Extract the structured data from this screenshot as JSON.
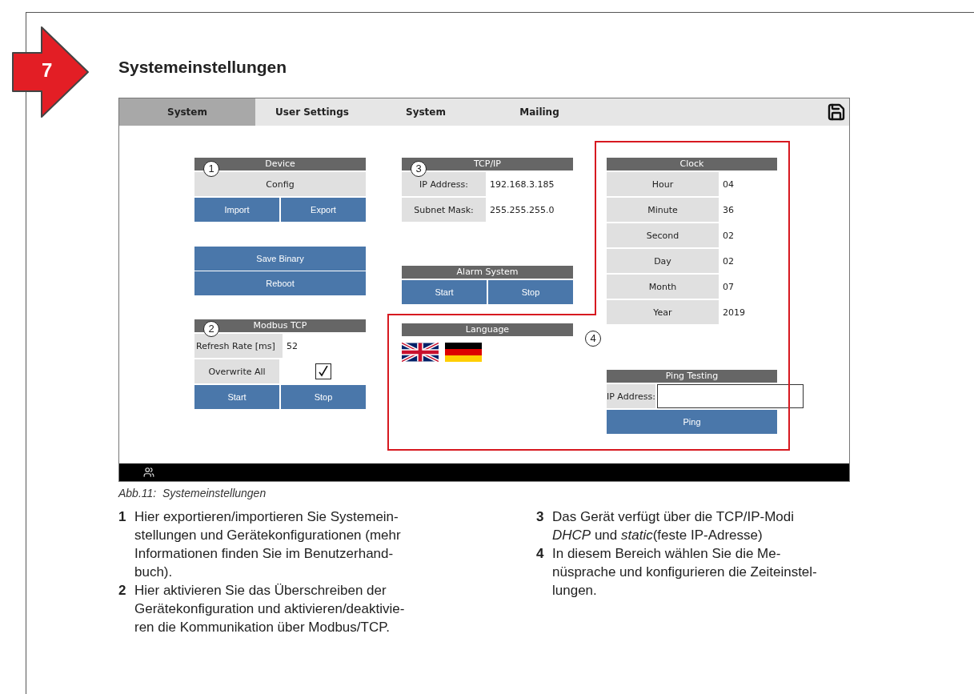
{
  "badge": {
    "number": "7"
  },
  "heading": "Systemeinstellungen",
  "figure": {
    "tabs": [
      {
        "label": "System",
        "selected": true
      },
      {
        "label": "User Settings",
        "selected": false
      },
      {
        "label": "System",
        "selected": false
      },
      {
        "label": "Mailing",
        "selected": false
      }
    ],
    "device": {
      "title": "Device",
      "callout": "1",
      "label": "Config",
      "buttons": [
        "Import",
        "Export"
      ]
    },
    "system_buttons": [
      "Save Binary",
      "Reboot"
    ],
    "modbus": {
      "title": "Modbus TCP",
      "callout": "2",
      "refresh_label": "Refresh Rate [ms]",
      "refresh_value": "52",
      "overwrite_label": "Overwrite All",
      "overwrite_checked": true,
      "buttons": [
        "Start",
        "Stop"
      ]
    },
    "tcpip": {
      "title": "TCP/IP",
      "callout": "3",
      "rows": [
        {
          "label": "IP Address:",
          "value": "192.168.3.185"
        },
        {
          "label": "Subnet Mask:",
          "value": "255.255.255.0"
        }
      ]
    },
    "alarm": {
      "title": "Alarm System",
      "buttons": [
        "Start",
        "Stop"
      ]
    },
    "language": {
      "title": "Language",
      "flags": [
        {
          "kind": "uk"
        },
        {
          "kind": "de"
        }
      ]
    },
    "area_callout": "4",
    "clock": {
      "title": "Clock",
      "rows": [
        {
          "label": "Hour",
          "value": "04"
        },
        {
          "label": "Minute",
          "value": "36"
        },
        {
          "label": "Second",
          "value": "02"
        },
        {
          "label": "Day",
          "value": "02"
        },
        {
          "label": "Month",
          "value": "07"
        },
        {
          "label": "Year",
          "value": "2019"
        }
      ]
    },
    "ping": {
      "title": "Ping Testing",
      "label": "IP Address:",
      "button": "Ping"
    }
  },
  "caption": "Abb.11:  Systemeinstellungen",
  "notes": [
    [
      {
        "number": "1",
        "lines": [
          "Hier exportieren/importieren Sie Systemein-",
          "stellungen und Gerätekonfigurationen (mehr",
          "Informationen finden Sie im Benutzerhand-",
          "buch)."
        ]
      },
      {
        "number": "2",
        "lines": [
          "Hier aktivieren Sie das Überschreiben der",
          "Gerätekonfiguration und aktivieren/deaktivie-",
          "ren die Kommunikation über Modbus/TCP."
        ]
      }
    ],
    [
      {
        "number": "3",
        "lines": [
          "Das Gerät verfügt über die TCP/IP-Modi",
          "*DHCP* und *static*(feste IP-Adresse)"
        ]
      },
      {
        "number": "4",
        "lines": [
          "In diesem Bereich wählen Sie die Me-",
          "nüsprache und konfigurieren die Zeiteinstel-",
          "lungen."
        ]
      }
    ]
  ]
}
